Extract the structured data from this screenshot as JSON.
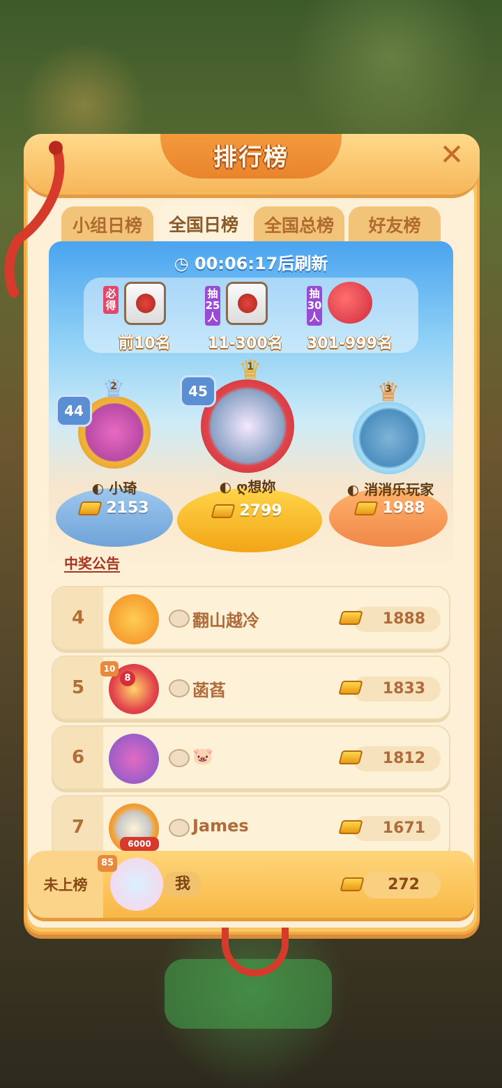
{
  "background": {
    "title": "",
    "button_label": ""
  },
  "header": {
    "title": "排行榜",
    "close_icon": "close-icon"
  },
  "tabs": [
    {
      "label": "小组日榜",
      "active": false
    },
    {
      "label": "全国日榜",
      "active": true
    },
    {
      "label": "全国总榜",
      "active": false
    },
    {
      "label": "好友榜",
      "active": false
    }
  ],
  "timer": {
    "text": "00:06:17后刷新",
    "icon": "clock-icon"
  },
  "prizes": [
    {
      "tag": "必得",
      "range": "前10名",
      "item": "gift-bag"
    },
    {
      "tag": "抽25人",
      "range": "11-300名",
      "item": "gift-bag"
    },
    {
      "tag": "抽30人",
      "range": "301-999名",
      "item": "fox-plush"
    }
  ],
  "podium": [
    {
      "place": "2",
      "level": "44",
      "name": "小琦",
      "score": "2153"
    },
    {
      "place": "1",
      "level": "45",
      "name": "ღ想妳",
      "score": "2799"
    },
    {
      "place": "3",
      "level": "",
      "name": "消消乐玩家",
      "score": "1988"
    }
  ],
  "notice": "中奖公告",
  "rows": [
    {
      "rank": "4",
      "name": "翻山越冷",
      "score": "1888"
    },
    {
      "rank": "5",
      "name": "菡萏",
      "score": "1833",
      "level": "10",
      "frame_level": "8"
    },
    {
      "rank": "6",
      "name": "🐷",
      "score": "1812"
    },
    {
      "rank": "7",
      "name": "James",
      "score": "1671",
      "badge": "6000"
    }
  ],
  "me": {
    "rank": "未上榜",
    "name": "我",
    "score": "272",
    "level": "85"
  },
  "colors": {
    "accent": "#f6b659",
    "panel": "#fdf0d6",
    "rank_text": "#b36e36"
  }
}
